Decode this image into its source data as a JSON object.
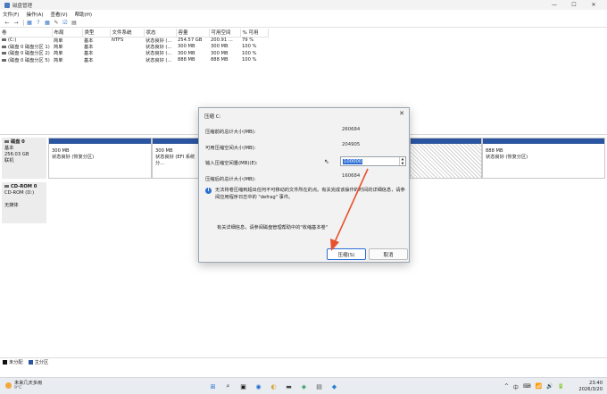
{
  "window": {
    "title": "磁盘管理",
    "controls": [
      "—",
      "☐",
      "✕"
    ]
  },
  "menu": [
    "文件(F)",
    "操作(A)",
    "查看(V)",
    "帮助(H)"
  ],
  "toolbar": [
    "←",
    "→",
    "▦",
    "?",
    "▦",
    "✎",
    "☑",
    "▤"
  ],
  "volume_table": {
    "headers": [
      "卷",
      "布局",
      "类型",
      "文件系统",
      "状态",
      "容量",
      "可用空间",
      "% 可用"
    ],
    "rows": [
      [
        "(C:)",
        "简单",
        "基本",
        "NTFS",
        "状态良好 (...",
        "254.57 GB",
        "200.91 ...",
        "79 %"
      ],
      [
        "(磁盘 0 磁盘分区 1)",
        "简单",
        "基本",
        "",
        "状态良好 (...",
        "300 MB",
        "300 MB",
        "100 %"
      ],
      [
        "(磁盘 0 磁盘分区 2)",
        "简单",
        "基本",
        "",
        "状态良好 (...",
        "300 MB",
        "300 MB",
        "100 %"
      ],
      [
        "(磁盘 0 磁盘分区 5)",
        "简单",
        "基本",
        "",
        "状态良好 (...",
        "888 MB",
        "888 MB",
        "100 %"
      ]
    ]
  },
  "disks": [
    {
      "name": "磁盘 0",
      "lines": [
        "基本",
        "256.03 GB",
        "联机"
      ],
      "partitions": [
        {
          "size": "300 MB",
          "status": "状态良好 (恢复分区)"
        },
        {
          "size": "300 MB",
          "status": "状态良好 (EFI 系统分..."
        },
        {
          "size": "",
          "status": ""
        },
        {
          "size": "888 MB",
          "status": "状态良好 (恢复分区)"
        }
      ]
    },
    {
      "name": "CD-ROM 0",
      "lines": [
        "CD-ROM (D:)",
        "",
        "无媒体"
      ]
    }
  ],
  "legend": [
    {
      "label": "未分配",
      "color": "#111111"
    },
    {
      "label": "主分区",
      "color": "#2b55a0"
    }
  ],
  "dialog": {
    "title": "压缩 C:",
    "rows": [
      {
        "label": "压缩前的总计大小(MB):",
        "value": "260684"
      },
      {
        "label": "可用压缩空间大小(MB):",
        "value": "204905"
      },
      {
        "label": "输入压缩空间量(MB)(E):",
        "value": "100000"
      },
      {
        "label": "压缩后的总计大小(MB):",
        "value": "160684"
      }
    ],
    "info": "无法将卷压缩到超出任何不可移动的文件所在的点。有关完成该操作的时间的详细信息，请参阅应用程序日志中的 \"defrag\" 事件。",
    "help": "有关详细信息，请参阅磁盘管理帮助中的\"收缩基本卷\"",
    "buttons": {
      "ok": "压缩(S)",
      "cancel": "取消"
    }
  },
  "taskbar": {
    "weather_title": "未来几天多雨",
    "weather_temp": "9°C",
    "apps": [
      "⊞",
      "⌕",
      "▣",
      "◉",
      "◐",
      "▬",
      "◈",
      "▤",
      "◆"
    ],
    "tray": [
      "^",
      "中",
      "⌨",
      "📶",
      "🔊",
      "🔋"
    ],
    "time": "23:40",
    "date": "2026/3/20"
  },
  "colors": {
    "accent": "#2f6fd6",
    "partition_bar": "#2b55a0",
    "arrow": "#e8512e"
  }
}
